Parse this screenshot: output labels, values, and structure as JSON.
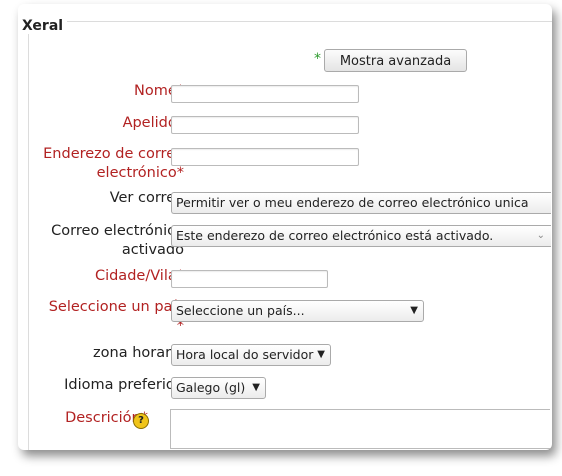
{
  "section": {
    "legend": "Xeral"
  },
  "advanced": {
    "marker": "*",
    "button_label": "Mostra avanzada"
  },
  "fields": {
    "firstname": {
      "label": "Nome*"
    },
    "lastname": {
      "label": "Apelido*"
    },
    "email": {
      "label_line1": "Enderezo de correo",
      "label_line2": "electrónico*"
    },
    "maildisplay": {
      "label": "Ver correo",
      "value": "Permitir ver o meu enderezo de correo electrónico unica"
    },
    "emailstop": {
      "label_line1": "Correo electrónico",
      "label_line2": "activado",
      "value": "Este enderezo de correo electrónico está activado."
    },
    "city": {
      "label": "Cidade/Vila*"
    },
    "country": {
      "label_line1": "Seleccione un país",
      "label_line2": "*",
      "value": "Seleccione un país..."
    },
    "timezone": {
      "label": "zona horaria",
      "value": "Hora local do servidor"
    },
    "lang": {
      "label": "Idioma preferido",
      "value": "Galego (gl)"
    },
    "description": {
      "label": "Descrición*",
      "help_icon": "question-circle-icon"
    }
  },
  "colors": {
    "required_label": "#b22222",
    "advanced_marker": "#2e9b2e"
  }
}
